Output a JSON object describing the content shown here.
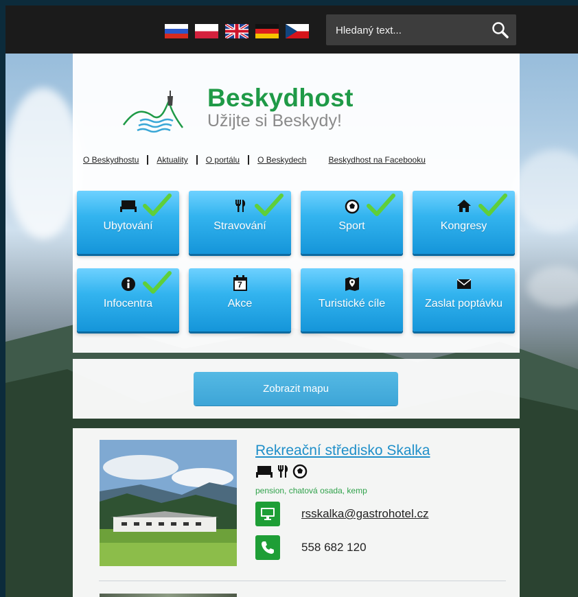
{
  "header": {
    "languages": [
      {
        "name": "russian-flag-icon"
      },
      {
        "name": "polish-flag-icon"
      },
      {
        "name": "english-flag-icon"
      },
      {
        "name": "german-flag-icon"
      },
      {
        "name": "czech-flag-icon"
      }
    ],
    "search": {
      "placeholder": "Hledaný text...",
      "value": "",
      "icon": "search-icon"
    }
  },
  "brand": {
    "name": "Beskydhost",
    "slogan": "Užijte si Beskydy!",
    "color": "#1f9a47"
  },
  "nav": [
    {
      "label": "O Beskydhostu"
    },
    {
      "label": "Aktuality"
    },
    {
      "label": "O portálu"
    },
    {
      "label": "O Beskydech"
    },
    {
      "label": "Beskydhost na Facebooku"
    }
  ],
  "categories": [
    {
      "label": "Ubytování",
      "icon": "bed-icon",
      "checked": true
    },
    {
      "label": "Stravování",
      "icon": "fork-knife-icon",
      "checked": true
    },
    {
      "label": "Sport",
      "icon": "soccer-ball-icon",
      "checked": true
    },
    {
      "label": "Kongresy",
      "icon": "home-icon",
      "checked": true
    },
    {
      "label": "Infocentra",
      "icon": "info-icon",
      "checked": true
    },
    {
      "label": "Akce",
      "icon": "calendar-icon",
      "calendar_day": "7",
      "checked": false
    },
    {
      "label": "Turistické cíle",
      "icon": "map-pin-icon",
      "checked": false
    },
    {
      "label": "Zaslat poptávku",
      "icon": "envelope-icon",
      "checked": false
    }
  ],
  "map_button": {
    "label": "Zobrazit mapu"
  },
  "results": [
    {
      "title": "Rekreační středisko Skalka",
      "icons": [
        "bed-icon",
        "fork-knife-icon",
        "soccer-ball-icon"
      ],
      "tags": "pension, chatová osada, kemp",
      "email": "rsskalka@gastrohotel.cz",
      "phone": "558 682 120"
    }
  ],
  "colors": {
    "tile": "#33b4ef",
    "accent_green": "#1e9e36",
    "link": "#1f8fc9",
    "topbar": "#1b1b1b"
  }
}
